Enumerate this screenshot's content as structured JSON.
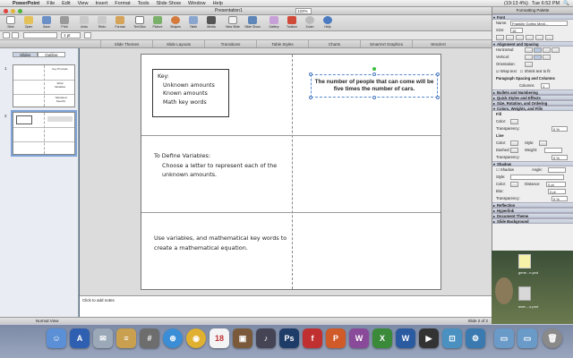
{
  "menubar": {
    "apple": "",
    "app": "PowerPoint",
    "items": [
      "File",
      "Edit",
      "View",
      "Insert",
      "Format",
      "Tools",
      "Slide Show",
      "Window",
      "Help"
    ],
    "clock": "Tue 6:52 PM",
    "battery": "(19:13 4%)"
  },
  "window": {
    "title": "Presentation1",
    "zoom": "122%"
  },
  "toolbar": {
    "buttons": [
      "New",
      "Open",
      "Save",
      "Print",
      "Undo",
      "Redo",
      "Format",
      "Text Box",
      "Picture",
      "Shapes",
      "Table",
      "Media",
      "New Slide",
      "Slide Show",
      "Gallery",
      "Toolbox",
      "Zoom",
      "Help"
    ]
  },
  "formatbar": {
    "line_weight": "1 pt"
  },
  "ribbon": {
    "tabs": [
      "Slide Themes",
      "Slide Layouts",
      "Transitions",
      "Table Styles",
      "Charts",
      "SmartArt Graphics",
      "WordArt"
    ]
  },
  "leftpane": {
    "tabs": [
      "Slides",
      "Outline"
    ],
    "slide1": {
      "num": "1",
      "cells": [
        "Key Principle",
        "What Variables",
        "Tabulated Specific"
      ]
    },
    "slide2": {
      "num": "2"
    }
  },
  "slide": {
    "key_title": "Key:",
    "key_items": [
      "Unknown amounts",
      "Known amounts",
      "Math key words"
    ],
    "textbox": "The number of people that can come will be five times the number of cars.",
    "define_title": "To Define Variables:",
    "define_body": "Choose a letter to represent each of the unknown amounts.",
    "usevars": "Use variables, and mathematical key words to create a mathematical equation."
  },
  "notes": {
    "placeholder": "Click to add notes"
  },
  "status": {
    "view": "Normal View",
    "slide": "Slide 2 of 2"
  },
  "palette": {
    "title": "Formatting Palette",
    "font_section": "Font",
    "font_name_label": "Name:",
    "font_name": "Franklin Gothic Medi...",
    "size_label": "Size:",
    "size": "16",
    "align_section": "Alignment and Spacing",
    "horizontal": "Horizontal:",
    "vertical": "Vertical:",
    "orientation": "Orientation:",
    "wrap": "Wrap text",
    "shrink": "Shrink text to fit",
    "para_spacing": "Paragraph Spacing and Columns",
    "columns_label": "Columns",
    "columns": "1",
    "bullets": "Bullets and Numbering",
    "quickstyles": "Quick Styles and Effects",
    "size_rot": "Size, Rotation, and Ordering",
    "colors_section": "Colors, Weights, and Fills",
    "fill_label": "Fill",
    "color_label": "Color:",
    "transparency_label": "Transparency:",
    "transparency_value": "0 %",
    "line_label": "Line",
    "style_label": "Style:",
    "dashed_label": "Dashed:",
    "weight_label": "Weight:",
    "shadow_section": "Shadow",
    "shadow_label": "Shadow",
    "angle_label": "Angle:",
    "distance_label": "Distance:",
    "blur_label": "Blur:",
    "distance_value": "0 pt",
    "blur_value": "0 pt",
    "reflection": "Reflection",
    "hyperlink": "Hyperlink",
    "doc_theme": "Document Theme",
    "slide_bg": "Slide Background"
  },
  "desktop": {
    "file1": "gene...n.pxd",
    "file2": "mee....x.pxd"
  },
  "colors": {
    "accent": "#4a7ac2",
    "rotate": "#3cbf3c"
  }
}
